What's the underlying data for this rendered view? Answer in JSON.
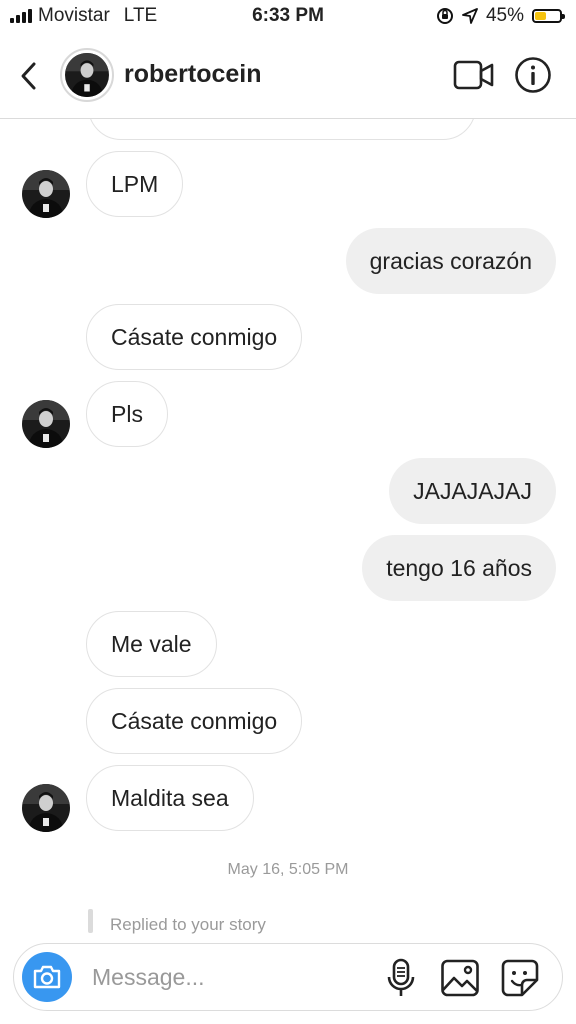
{
  "status_bar": {
    "carrier": "Movistar",
    "network": "LTE",
    "time": "6:33 PM",
    "battery_percent": "45%",
    "battery_level": 0.45,
    "battery_color": "#f5c30f"
  },
  "header": {
    "username": "robertocein",
    "icons": [
      "back-chevron-icon",
      "avatar",
      "video-call-icon",
      "info-icon"
    ]
  },
  "messages": [
    {
      "direction": "in",
      "text": "",
      "avatar": false
    },
    {
      "direction": "in",
      "text": "LPM",
      "avatar": true
    },
    {
      "direction": "out",
      "text": "gracias corazón"
    },
    {
      "direction": "in",
      "text": "Cásate conmigo",
      "avatar": false
    },
    {
      "direction": "in",
      "text": "Pls",
      "avatar": true
    },
    {
      "direction": "out",
      "text": "JAJAJAJAJ"
    },
    {
      "direction": "out",
      "text": "tengo 16 años"
    },
    {
      "direction": "in",
      "text": "Me vale",
      "avatar": false
    },
    {
      "direction": "in",
      "text": "Cásate conmigo",
      "avatar": false
    },
    {
      "direction": "in",
      "text": "Maldita sea",
      "avatar": true
    }
  ],
  "timestamp": "May 16, 5:05 PM",
  "replied_story": "Replied to your story",
  "composer": {
    "placeholder": "Message...",
    "value": "",
    "accent_color": "#3897f0",
    "icons": [
      "camera-icon",
      "microphone-icon",
      "photo-gallery-icon",
      "sticker-icon"
    ]
  }
}
